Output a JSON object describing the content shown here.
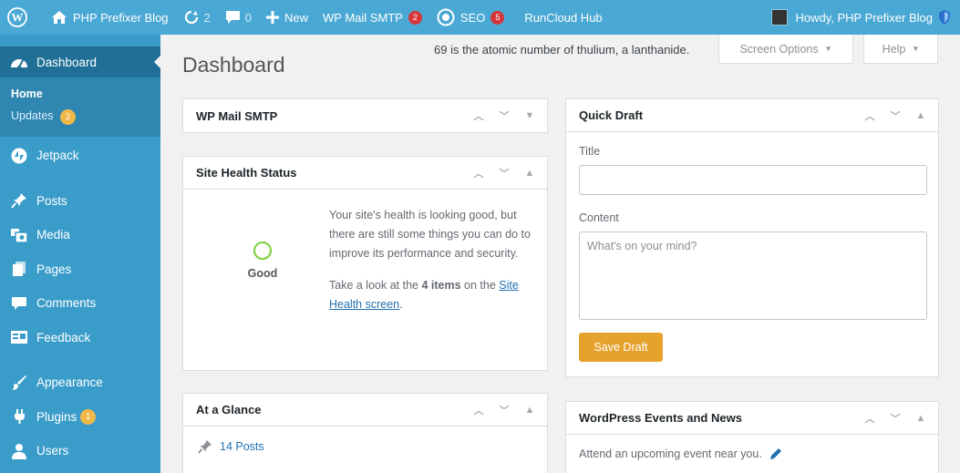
{
  "adminbar": {
    "site_name": "PHP Prefixer Blog",
    "updates_count": "2",
    "comments_count": "0",
    "new_label": "New",
    "smtp_label": "WP Mail SMTP",
    "smtp_badge": "2",
    "seo_label": "SEO",
    "seo_badge": "5",
    "runcloud_label": "RunCloud Hub",
    "howdy": "Howdy, PHP Prefixer Blog"
  },
  "sidebar": {
    "dashboard": "Dashboard",
    "home": "Home",
    "updates": "Updates",
    "updates_badge": "2",
    "jetpack": "Jetpack",
    "posts": "Posts",
    "media": "Media",
    "pages": "Pages",
    "comments": "Comments",
    "feedback": "Feedback",
    "appearance": "Appearance",
    "plugins": "Plugins",
    "plugins_badge": "1",
    "users": "Users"
  },
  "header": {
    "notice": "69 is the atomic number of thulium, a lanthanide.",
    "screen_options": "Screen Options",
    "help": "Help",
    "title": "Dashboard"
  },
  "widgets": {
    "smtp_title": "WP Mail SMTP",
    "health_title": "Site Health Status",
    "health_status": "Good",
    "health_text": "Your site's health is looking good, but there are still some things you can do to improve its performance and security.",
    "health_take_look_pre": "Take a look at the ",
    "health_items": "4 items",
    "health_take_look_mid": " on the ",
    "health_link": "Site Health screen",
    "health_take_look_end": ".",
    "glance_title": "At a Glance",
    "glance_posts": "14 Posts",
    "quickdraft_title": "Quick Draft",
    "qd_title_label": "Title",
    "qd_content_label": "Content",
    "qd_placeholder": "What's on your mind?",
    "qd_save": "Save Draft",
    "events_title": "WordPress Events and News",
    "events_text": "Attend an upcoming event near you."
  },
  "colors": {
    "adminbar": "#4aa8d4",
    "sidebar": "#3a9cc9",
    "sidebar_current": "#1f6f96",
    "accent_button": "#e5a22d",
    "badge_red": "#d63638",
    "badge_orange": "#f0b849"
  }
}
